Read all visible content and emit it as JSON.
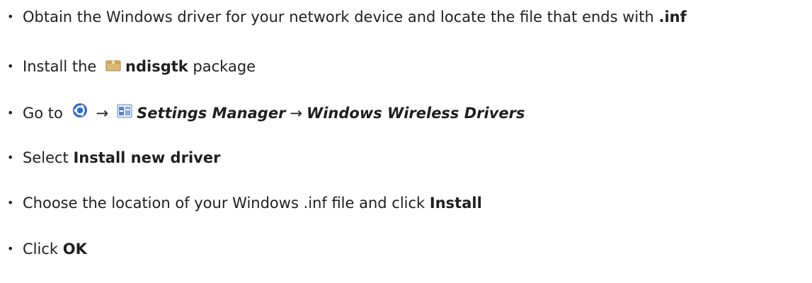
{
  "steps": [
    {
      "text_a": "Obtain the Windows driver for your network device and locate the file that ends with ",
      "bold": ".inf"
    },
    {
      "text_a": "Install the ",
      "icon": "package-icon",
      "bold": "ndisgtk",
      "text_b": " package"
    },
    {
      "text_a": "Go to ",
      "icon_menu": "ubuntu-menu-icon",
      "arrow": "→",
      "icon_settings": "settings-manager-icon",
      "italic_1": "Settings Manager",
      "arrow2": "→",
      "italic_2": "Windows Wireless Drivers"
    },
    {
      "text_a": "Select ",
      "bold": "Install new driver"
    },
    {
      "text_a": "Choose the location of your Windows .inf file and click ",
      "bold": "Install"
    },
    {
      "text_a": "Click ",
      "bold": "OK"
    }
  ],
  "bullet": "•",
  "colors": {
    "text": "#1f1f1f",
    "menu_icon_blue": "#2d6bd4",
    "package_brown": "#c9a766"
  }
}
